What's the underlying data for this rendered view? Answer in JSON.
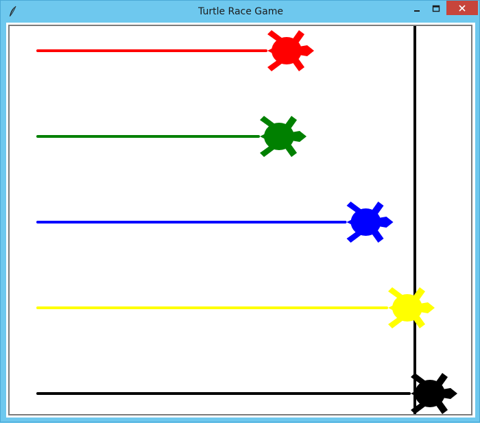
{
  "window": {
    "title": "Turtle Race Game",
    "icon": "feather-icon"
  },
  "controls": {
    "minimize_icon": "minimize-icon",
    "maximize_icon": "maximize-icon",
    "close_icon": "close-icon",
    "close_bg": "#c7453b"
  },
  "race": {
    "finish_line_color": "#000000",
    "turtles": [
      {
        "name": "red",
        "color": "#ff0000",
        "progress": 0.66
      },
      {
        "name": "green",
        "color": "#008000",
        "progress": 0.64
      },
      {
        "name": "blue",
        "color": "#0000ff",
        "progress": 0.87
      },
      {
        "name": "yellow",
        "color": "#ffff00",
        "progress": 0.98
      },
      {
        "name": "black",
        "color": "#000000",
        "progress": 1.04
      }
    ]
  }
}
